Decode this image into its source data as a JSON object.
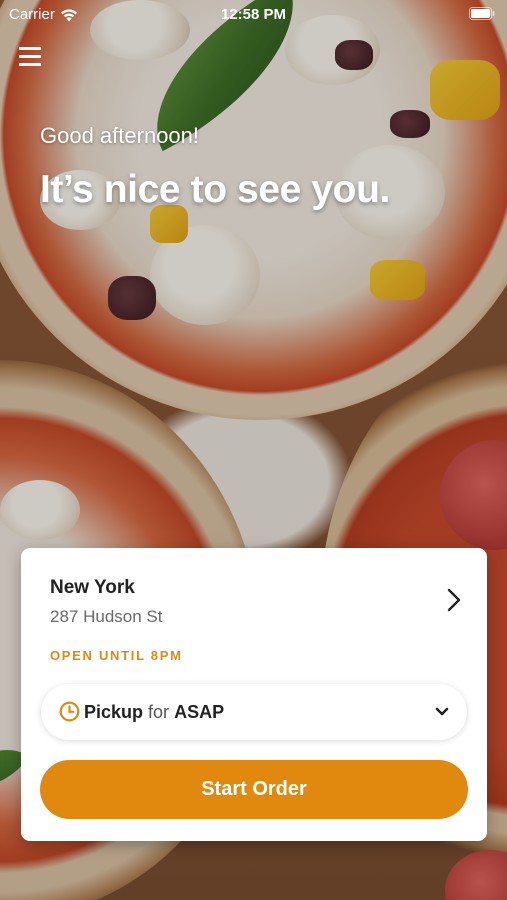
{
  "status_bar": {
    "carrier": "Carrier",
    "time": "12:58 PM"
  },
  "header": {
    "greeting": "Good afternoon!",
    "headline": "It’s nice to see you."
  },
  "location_card": {
    "city": "New York",
    "address": "287 Hudson St",
    "hours": "OPEN UNTIL 8PM",
    "pickup": {
      "mode": "Pickup",
      "connector": "for",
      "time": "ASAP"
    },
    "start_button_label": "Start Order"
  },
  "colors": {
    "accent": "#e0890e",
    "hours_text": "#dc8b12",
    "card_bg": "#ffffff"
  },
  "icons": [
    "wifi-icon",
    "battery-icon",
    "menu-icon",
    "chevron-right-icon",
    "clock-icon",
    "chevron-down-icon"
  ]
}
